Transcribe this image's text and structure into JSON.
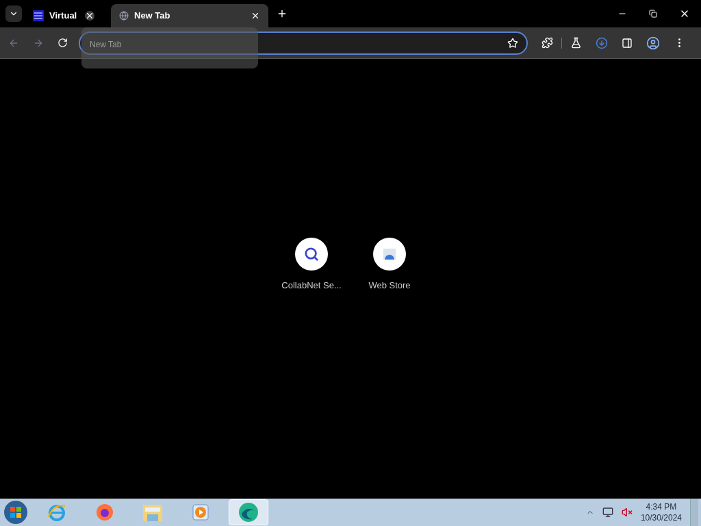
{
  "tabs": [
    {
      "title": "Virtual",
      "selected": false
    },
    {
      "title": "New Tab",
      "selected": true
    }
  ],
  "hover_card": {
    "title": "New Tab"
  },
  "shortcuts": [
    {
      "label": "CollabNet Se...",
      "kind": "search"
    },
    {
      "label": "Web Store",
      "kind": "store"
    }
  ],
  "taskbar": {
    "apps": [
      {
        "kind": "ie",
        "selected": false
      },
      {
        "kind": "firefox",
        "selected": false
      },
      {
        "kind": "folder",
        "selected": false
      },
      {
        "kind": "media",
        "selected": false
      },
      {
        "kind": "edge",
        "selected": true
      }
    ],
    "time": "4:34 PM",
    "date": "10/30/2024"
  }
}
